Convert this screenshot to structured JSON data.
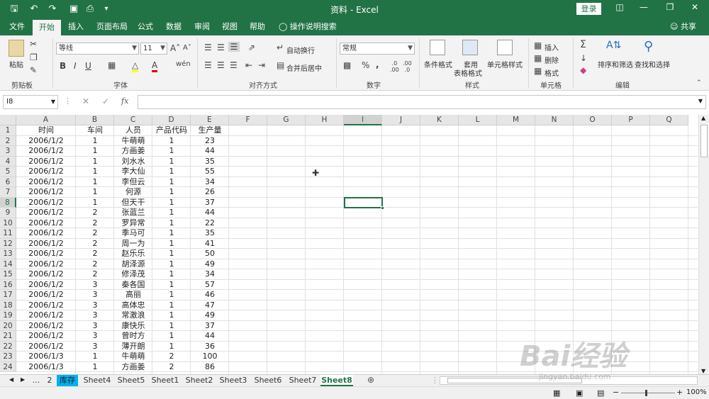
{
  "titlebar": {
    "title": "资料 - Excel",
    "login": "登录",
    "icons": [
      "save-icon",
      "undo-icon",
      "redo-icon",
      "camera-icon",
      "print-icon",
      "customize-icon"
    ],
    "window": [
      "ribbon-display-icon",
      "minimize-icon",
      "restore-icon",
      "close-icon"
    ]
  },
  "tabs": [
    {
      "label": "文件"
    },
    {
      "label": "开始"
    },
    {
      "label": "插入"
    },
    {
      "label": "页面布局"
    },
    {
      "label": "公式"
    },
    {
      "label": "数据"
    },
    {
      "label": "审阅"
    },
    {
      "label": "视图"
    },
    {
      "label": "帮助"
    }
  ],
  "tell_me": "操作说明搜索",
  "share": "共享",
  "ribbon": {
    "clipboard": {
      "paste": "粘贴",
      "label": "剪贴板"
    },
    "font": {
      "name": "等线",
      "size": "11",
      "bold": "B",
      "italic": "I",
      "underline": "U",
      "label": "字体"
    },
    "alignment": {
      "wrap": "自动换行",
      "merge": "合并后居中",
      "label": "对齐方式"
    },
    "number": {
      "format": "常规",
      "percent": "%",
      "comma": ",",
      "label": "数字"
    },
    "styles": {
      "conditional": "条件格式",
      "table1": "套用",
      "table2": "表格格式",
      "cell": "单元格样式",
      "label": "样式"
    },
    "cells": {
      "insert": "插入",
      "delete": "删除",
      "format": "格式",
      "label": "单元格"
    },
    "editing": {
      "sort": "排序和筛选",
      "find": "查找和选择",
      "label": "编辑"
    }
  },
  "namebox": "I8",
  "columns": [
    "A",
    "B",
    "C",
    "D",
    "E",
    "F",
    "G",
    "H",
    "I",
    "J",
    "K",
    "L",
    "M",
    "N",
    "O",
    "P",
    "Q"
  ],
  "selected_column": "I",
  "selected_row": "8",
  "headers": [
    "时间",
    "车间",
    "人员",
    "产品代码",
    "生产量"
  ],
  "rows": [
    [
      "2006/1/2",
      "1",
      "牛萌萌",
      "1",
      "23"
    ],
    [
      "2006/1/2",
      "1",
      "方画姜",
      "1",
      "44"
    ],
    [
      "2006/1/2",
      "1",
      "刘水水",
      "1",
      "35"
    ],
    [
      "2006/1/2",
      "1",
      "李大仙",
      "1",
      "55"
    ],
    [
      "2006/1/2",
      "1",
      "李但云",
      "1",
      "34"
    ],
    [
      "2006/1/2",
      "1",
      "何源",
      "1",
      "26"
    ],
    [
      "2006/1/2",
      "1",
      "但天干",
      "1",
      "37"
    ],
    [
      "2006/1/2",
      "2",
      "张蓝兰",
      "1",
      "44"
    ],
    [
      "2006/1/2",
      "2",
      "罗异常",
      "1",
      "22"
    ],
    [
      "2006/1/2",
      "2",
      "季马可",
      "1",
      "35"
    ],
    [
      "2006/1/2",
      "2",
      "周一为",
      "1",
      "41"
    ],
    [
      "2006/1/2",
      "2",
      "赵乐乐",
      "1",
      "50"
    ],
    [
      "2006/1/2",
      "2",
      "胡泽源",
      "1",
      "49"
    ],
    [
      "2006/1/2",
      "2",
      "修泽茂",
      "1",
      "34"
    ],
    [
      "2006/1/2",
      "3",
      "秦各国",
      "1",
      "57"
    ],
    [
      "2006/1/2",
      "3",
      "高丽",
      "1",
      "46"
    ],
    [
      "2006/1/2",
      "3",
      "高体忠",
      "1",
      "47"
    ],
    [
      "2006/1/2",
      "3",
      "常激浪",
      "1",
      "49"
    ],
    [
      "2006/1/2",
      "3",
      "康快乐",
      "1",
      "37"
    ],
    [
      "2006/1/2",
      "3",
      "曾时方",
      "1",
      "44"
    ],
    [
      "2006/1/2",
      "3",
      "薄开朗",
      "1",
      "36"
    ],
    [
      "2006/1/3",
      "1",
      "牛萌萌",
      "2",
      "100"
    ],
    [
      "2006/1/3",
      "1",
      "方画姜",
      "2",
      "86"
    ]
  ],
  "sheets": [
    {
      "label": "...",
      "type": "normal"
    },
    {
      "label": "2",
      "type": "normal"
    },
    {
      "label": "库存",
      "type": "colored"
    },
    {
      "label": "Sheet4",
      "type": "normal"
    },
    {
      "label": "Sheet5",
      "type": "normal"
    },
    {
      "label": "Sheet1",
      "type": "normal"
    },
    {
      "label": "Sheet2",
      "type": "normal"
    },
    {
      "label": "Sheet3",
      "type": "normal"
    },
    {
      "label": "Sheet6",
      "type": "normal"
    },
    {
      "label": "Sheet7",
      "type": "normal"
    },
    {
      "label": "Sheet8",
      "type": "active"
    }
  ],
  "zoom": "100%",
  "watermark": "Bai经验",
  "watermark_url": "jingyan.baidu.com",
  "colors": {
    "accent": "#217346",
    "sheet_tab": "#00b0f0"
  }
}
